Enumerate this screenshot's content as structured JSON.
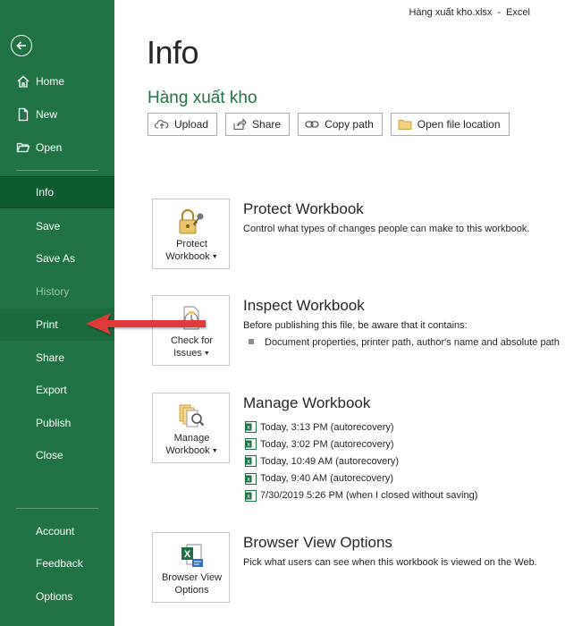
{
  "titlebar": {
    "filename": "Hàng xuất kho.xlsx",
    "separator": "-",
    "app": "Excel"
  },
  "sidebar": {
    "items": [
      {
        "label": "Home"
      },
      {
        "label": "New"
      },
      {
        "label": "Open"
      },
      {
        "label": "Info"
      },
      {
        "label": "Save"
      },
      {
        "label": "Save As"
      },
      {
        "label": "History"
      },
      {
        "label": "Print"
      },
      {
        "label": "Share"
      },
      {
        "label": "Export"
      },
      {
        "label": "Publish"
      },
      {
        "label": "Close"
      },
      {
        "label": "Account"
      },
      {
        "label": "Feedback"
      },
      {
        "label": "Options"
      }
    ],
    "active": "Info",
    "disabled": "History"
  },
  "main": {
    "title": "Info",
    "file_name": "Hàng xuất kho",
    "toolbar": {
      "upload": "Upload",
      "share": "Share",
      "copy_path": "Copy path",
      "open_location": "Open file location"
    }
  },
  "sections": {
    "protect": {
      "button_line1": "Protect",
      "button_line2": "Workbook",
      "title": "Protect Workbook",
      "description": "Control what types of changes people can make to this workbook."
    },
    "inspect": {
      "button_line1": "Check for",
      "button_line2": "Issues",
      "title": "Inspect Workbook",
      "description": "Before publishing this file, be aware that it contains:",
      "bullet": "Document properties, printer path, author's name and absolute path"
    },
    "manage": {
      "button_line1": "Manage",
      "button_line2": "Workbook",
      "title": "Manage Workbook",
      "versions": [
        "Today, 3:13 PM (autorecovery)",
        "Today, 3:02 PM (autorecovery)",
        "Today, 10:49 AM (autorecovery)",
        "Today, 9:40 AM (autorecovery)",
        "7/30/2019 5:26 PM (when I closed without saving)"
      ]
    },
    "browser": {
      "button_line1": "Browser View",
      "button_line2": "Options",
      "title": "Browser View Options",
      "description": "Pick what users can see when this workbook is viewed on the Web."
    }
  },
  "colors": {
    "sidebar_bg": "#217346",
    "sidebar_active": "#0e5c2f",
    "accent_green": "#217346",
    "arrow_red": "#e03a3a"
  },
  "icons": {
    "back": "back-arrow-icon",
    "home": "home-icon",
    "new": "new-document-icon",
    "open": "open-folder-icon",
    "upload": "upload-cloud-icon",
    "share": "share-icon",
    "copy_path": "link-icon",
    "open_location": "folder-icon",
    "protect": "lock-key-icon",
    "inspect": "inspect-document-icon",
    "manage": "manage-documents-icon",
    "browser": "excel-browser-icon",
    "version": "excel-file-icon"
  }
}
